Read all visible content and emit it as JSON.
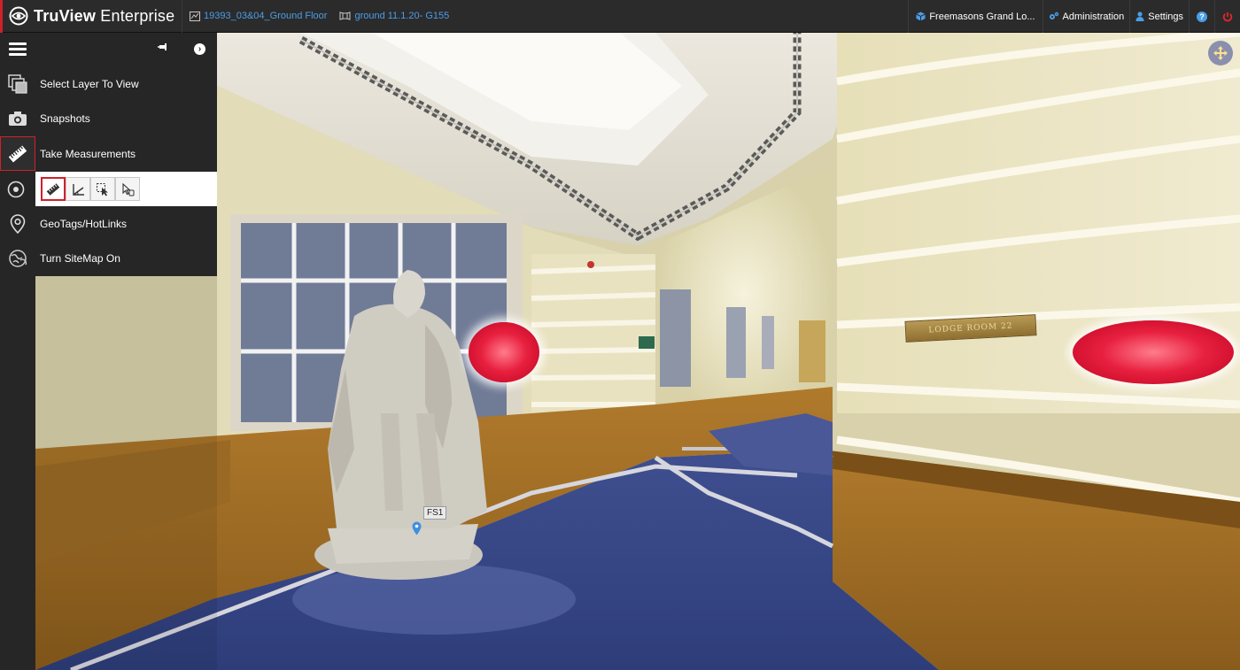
{
  "app": {
    "name_strong": "TruView",
    "name_light": " Enterprise",
    "breadcrumb_site": "19393_03&04_Ground Floor",
    "breadcrumb_scan": "ground 11.1.20- G155"
  },
  "topbar": {
    "project": "Freemasons Grand Lo...",
    "administration": "Administration",
    "settings": "Settings",
    "help_glyph": "?"
  },
  "sidebar": {
    "items": [
      {
        "label": "Select Layer To View",
        "icon": "layers-icon"
      },
      {
        "label": "Snapshots",
        "icon": "camera-icon"
      },
      {
        "label": "Take Measurements",
        "icon": "ruler-icon"
      },
      {
        "label": "",
        "icon": "target-icon"
      },
      {
        "label": "GeoTags/HotLinks",
        "icon": "location-pin-icon"
      },
      {
        "label": "Turn SiteMap On",
        "icon": "sitemap-icon"
      }
    ],
    "measure_tools": [
      "ruler-tool-icon",
      "angle-tool-icon",
      "area-select-tool-icon",
      "point-tool-icon"
    ]
  },
  "viewer": {
    "geotag_label": "FS1",
    "plaque_text": "LODGE ROOM 22"
  },
  "colors": {
    "accent_red": "#d0202a",
    "link_blue": "#4a9ee8",
    "bar_bg": "#2b2b2b",
    "sidebar_bg": "#262626",
    "hotspot_red": "#e8203f"
  }
}
